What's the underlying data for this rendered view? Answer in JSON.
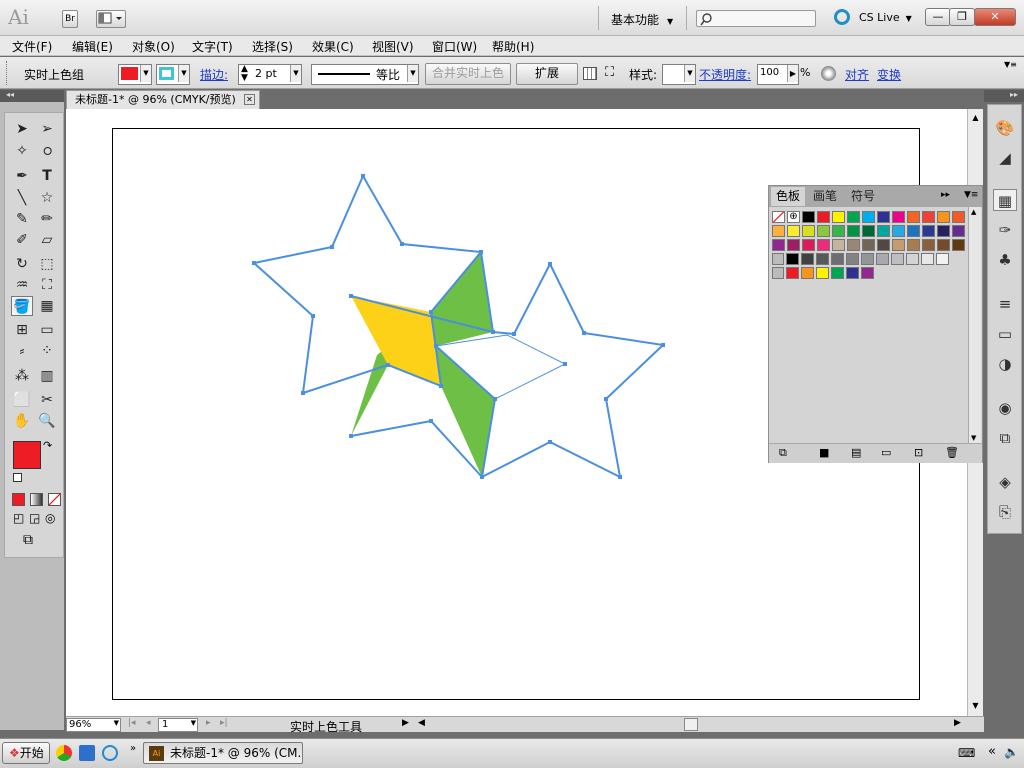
{
  "app": {
    "logo_text": "Ai",
    "bridge_label": "Br",
    "workspace_label": "基本功能",
    "cslive_label": "CS Live"
  },
  "window_buttons": {
    "minimize": "—",
    "restore": "❐",
    "close": "✕"
  },
  "menu": [
    "文件(F)",
    "编辑(E)",
    "对象(O)",
    "文字(T)",
    "选择(S)",
    "效果(C)",
    "视图(V)",
    "窗口(W)",
    "帮助(H)"
  ],
  "control": {
    "selection_label": "实时上色组",
    "fill_color": "#ee1c25",
    "stroke_color": "#3cc8d2",
    "stroke_label": "描边:",
    "stroke_weight": "2 pt",
    "profile_label": "等比",
    "merge_button": "合并实时上色",
    "expand_button": "扩展",
    "style_label": "样式:",
    "opacity_label": "不透明度:",
    "opacity_value": "100",
    "percent": "%",
    "align_label": "对齐",
    "transform_label": "变换"
  },
  "document": {
    "tab_title": "未标题-1* @ 96% (CMYK/预览)",
    "zoom": "96%",
    "page": "1",
    "status_text": "实时上色工具"
  },
  "artwork": {
    "star_stroke_color": "#4a8fe0",
    "green_fill": "#6dbf45",
    "yellow_fill": "#fcd118"
  },
  "swatch_panel": {
    "tabs": [
      "色板",
      "画笔",
      "符号"
    ],
    "rows": [
      [
        "#ffffff",
        "#ffffff",
        "#000000",
        "#ed1c24",
        "#fff200",
        "#00a651",
        "#00aeef",
        "#2e3192",
        "#ec008c",
        "#f26522",
        "#ef4136",
        "#f7941d",
        "#f15a29"
      ],
      [
        "#fbb040",
        "#f9ed32",
        "#d7df23",
        "#8dc63f",
        "#39b54a",
        "#009444",
        "#006838",
        "#00a79d",
        "#27aae1",
        "#1c75bc",
        "#2b3990",
        "#262262",
        "#662d91"
      ],
      [
        "#92278f",
        "#9e1f63",
        "#da1c5c",
        "#ee2a7b",
        "#c2b59b",
        "#998675",
        "#726658",
        "#534741",
        "#c69c6d",
        "#a97c50",
        "#8b5e3c",
        "#754c29",
        "#603913"
      ],
      [
        "#000000",
        "#414042",
        "#58595b",
        "#6d6e71",
        "#808285",
        "#939598",
        "#a7a9ac",
        "#bcbec0",
        "#d1d3d4",
        "#e6e7e8",
        "#f1f2f2"
      ],
      [
        "#ed1c24",
        "#f7941d",
        "#fff200",
        "#00a651",
        "#2e3192",
        "#92278f"
      ]
    ]
  },
  "taskbar": {
    "start_label": "开始",
    "task_label": "未标题-1* @ 96% (CM..."
  }
}
